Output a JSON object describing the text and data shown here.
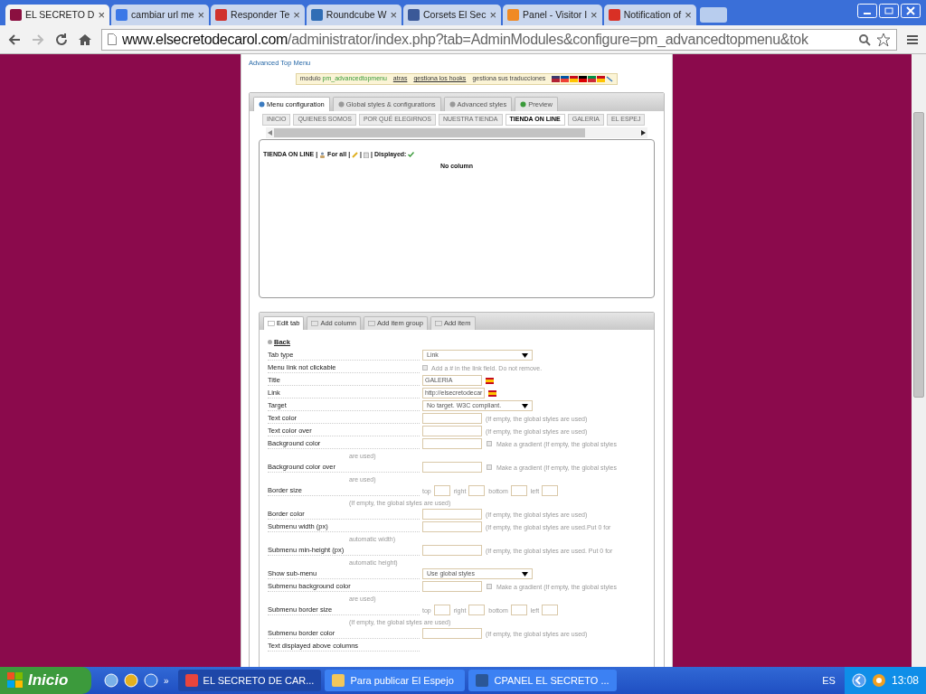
{
  "browser_tabs": [
    {
      "title": "EL SECRETO D",
      "close": "×",
      "selected": true,
      "color": "#8b1040"
    },
    {
      "title": "cambiar url me",
      "close": "×",
      "selected": false,
      "color": "#3b78e7"
    },
    {
      "title": "Responder Te",
      "close": "×",
      "selected": false,
      "color": "#d0322d"
    },
    {
      "title": "Roundcube W",
      "close": "×",
      "selected": false,
      "color": "#2f6db5"
    },
    {
      "title": "Corsets El Sec",
      "close": "×",
      "selected": false,
      "color": "#3b5998"
    },
    {
      "title": "Panel - Visitor I",
      "close": "×",
      "selected": false,
      "color": "#f08a24"
    },
    {
      "title": "Notification of",
      "close": "×",
      "selected": false,
      "color": "#d93025"
    }
  ],
  "address": {
    "host": "www.elsecretodecarol.com",
    "path": "/administrator/index.php?tab=AdminModules&configure=pm_advancedtopmenu&tok"
  },
  "page": {
    "heading": "Advanced Top Menu",
    "module_bar": {
      "module_label": "modulo",
      "module_name": "pm_advancedtopmenu",
      "links": [
        "atras",
        "gestiona los hooks"
      ],
      "translations": "gestiona sus traducciones"
    },
    "main_tabs": [
      {
        "label": "Menu configuration",
        "selected": true
      },
      {
        "label": "Global styles & configurations",
        "selected": false
      },
      {
        "label": "Advanced styles",
        "selected": false
      },
      {
        "label": "Preview",
        "selected": false
      }
    ],
    "menu_tabs": [
      {
        "label": "INICIO",
        "selected": false
      },
      {
        "label": "QUIENES SOMOS",
        "selected": false
      },
      {
        "label": "POR QUÉ ELEGIRNOS",
        "selected": false
      },
      {
        "label": "NUESTRA TIENDA",
        "selected": false
      },
      {
        "label": "TIENDA ON LINE",
        "selected": true
      },
      {
        "label": "GALERIA",
        "selected": false
      },
      {
        "label": "EL ESPEJ",
        "selected": false
      }
    ],
    "menu_header": {
      "title": "TIENDA ON LINE",
      "for_all": "For all",
      "separators": [
        "|",
        "|",
        "|",
        "|"
      ],
      "displayed_label": "Displayed:",
      "displayed": true
    },
    "empty_text": "No column",
    "edit_tabs": [
      {
        "label": "Edit tab",
        "selected": true
      },
      {
        "label": "Add column",
        "selected": false
      },
      {
        "label": "Add item group",
        "selected": false
      },
      {
        "label": "Add item",
        "selected": false
      }
    ],
    "back_link": "Back",
    "fields": [
      {
        "kind": "select",
        "label": "Tab type",
        "value": "Link"
      },
      {
        "kind": "checkbox",
        "label": "Menu link not clickable",
        "checked": false,
        "hint": "Add a # in the link field. Do not remove."
      },
      {
        "kind": "text",
        "label": "Title",
        "value": "GALERIA"
      },
      {
        "kind": "text",
        "label": "Link",
        "value": "http://elsecretodecar"
      },
      {
        "kind": "select",
        "label": "Target",
        "value": "No target. W3C compliant."
      },
      {
        "kind": "color",
        "label": "Text color",
        "hint": "(If empty, the global styles are used)"
      },
      {
        "kind": "color",
        "label": "Text color over",
        "hint": "(If empty, the global styles are used)"
      },
      {
        "kind": "gradient",
        "label": "Background color",
        "checked": false,
        "hint": "Make a gradient (If empty, the global styles",
        "hint_cont": "are used)"
      },
      {
        "kind": "gradient",
        "label": "Background color over",
        "checked": false,
        "hint": "Make a gradient (If empty, the global styles",
        "hint_cont": "are used)"
      },
      {
        "kind": "border",
        "label": "Border size",
        "sides": [
          "top",
          "right",
          "bottom",
          "left"
        ],
        "hint_cont": "(If empty, the global styles are used)"
      },
      {
        "kind": "color",
        "label": "Border color",
        "hint": "(If empty, the global styles are used)"
      },
      {
        "kind": "color",
        "label": "Submenu width (px)",
        "hint": "(If empty, the global styles are used.Put 0 for",
        "hint_cont": "automatic width)"
      },
      {
        "kind": "color",
        "label": "Submenu min-height (px)",
        "hint": "(If empty, the global styles are used. Put 0 for",
        "hint_cont": "automatic height)"
      },
      {
        "kind": "select",
        "label": "Show sub-menu",
        "value": "Use global styles"
      },
      {
        "kind": "gradient",
        "label": "Submenu background color",
        "checked": false,
        "hint": "Make a gradient (If empty, the global styles",
        "hint_cont": "are used)"
      },
      {
        "kind": "border",
        "label": "Submenu border size",
        "sides": [
          "top",
          "right",
          "bottom",
          "left"
        ],
        "hint_cont": "(If empty, the global styles are used)"
      },
      {
        "kind": "color",
        "label": "Submenu border color",
        "hint": "(If empty, the global styles are used)"
      },
      {
        "kind": "plain",
        "label": "Text displayed above columns"
      }
    ]
  },
  "taskbar": {
    "start": "Inicio",
    "more": "»",
    "windows": [
      {
        "title": "EL SECRETO DE CAR...",
        "selected": true,
        "kind": "browser"
      },
      {
        "title": "Para publicar El Espejo",
        "selected": false,
        "kind": "folder"
      },
      {
        "title": "CPANEL EL SECRETO ...",
        "selected": false,
        "kind": "document"
      }
    ],
    "language": "ES",
    "time": "13:08"
  }
}
